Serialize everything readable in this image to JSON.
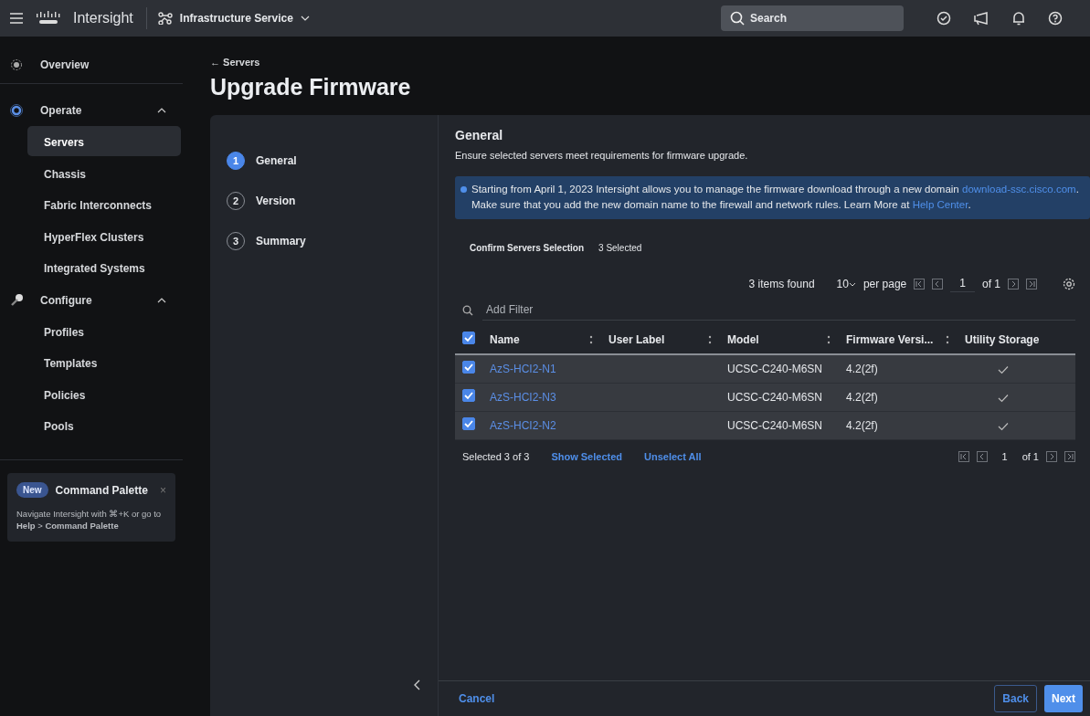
{
  "topbar": {
    "product": "Intersight",
    "service": "Infrastructure Service",
    "search": {
      "placeholder": "Search"
    }
  },
  "sidebar": {
    "items": [
      {
        "label": "Overview",
        "kind": "link"
      },
      {
        "label": "Operate",
        "kind": "group",
        "expanded": true,
        "children": [
          {
            "label": "Servers",
            "selected": true
          },
          {
            "label": "Chassis",
            "selected": false
          },
          {
            "label": "Fabric Interconnects",
            "selected": false
          },
          {
            "label": "HyperFlex Clusters",
            "selected": false
          },
          {
            "label": "Integrated Systems",
            "selected": false
          }
        ]
      },
      {
        "label": "Configure",
        "kind": "group",
        "expanded": true,
        "children": [
          {
            "label": "Profiles",
            "selected": false
          },
          {
            "label": "Templates",
            "selected": false
          },
          {
            "label": "Policies",
            "selected": false
          },
          {
            "label": "Pools",
            "selected": false
          }
        ]
      }
    ],
    "promo": {
      "badge": "New",
      "title": "Command Palette",
      "close": "×",
      "text": "Navigate Intersight with ⌘+K or go to **Help** > **Command Palette**"
    }
  },
  "page": {
    "back": "← Servers",
    "title": "Upgrade Firmware"
  },
  "steps": [
    {
      "number": "1",
      "label": "General",
      "selected": true
    },
    {
      "number": "2",
      "label": "Version",
      "selected": false
    },
    {
      "number": "3",
      "label": "Summary",
      "selected": false
    }
  ],
  "section": {
    "title": "General",
    "subtitle": "Ensure selected servers meet requirements for firmware upgrade.",
    "banner": [
      {
        "kind": "text",
        "text": "Starting from April 1, 2023 Intersight allows you to manage the firmware download through a new domain"
      },
      {
        "kind": "link",
        "text": "download-ssc.cisco.com"
      },
      {
        "kind": "text",
        "text": ". Make sure that you add the new domain name to the firewall and network rules. Learn More at"
      },
      {
        "kind": "link",
        "text": "Help Center"
      },
      {
        "kind": "text",
        "text": "."
      }
    ],
    "selection_label": "Confirm Servers Selection",
    "selection_count": "3 Selected"
  },
  "table": {
    "items_found": "3 items found",
    "page_size": "10",
    "per_page": "per page",
    "page": "1",
    "of_pages": "of 1",
    "filter": {
      "placeholder": "Add Filter"
    },
    "all_selected": true,
    "columns": [
      {
        "label": "Name",
        "sortable": true
      },
      {
        "label": "User Label",
        "sortable": true
      },
      {
        "label": "Model",
        "sortable": true
      },
      {
        "label": "Firmware Versi...",
        "sortable": true
      },
      {
        "label": "Utility Storage",
        "sortable": false
      }
    ],
    "rows": [
      {
        "selected": true,
        "name": "AzS-HCI2-N1",
        "model": "UCSC-C240-M6SN",
        "firmware": "4.2(2f)",
        "utility_storage": true
      },
      {
        "selected": true,
        "name": "AzS-HCI2-N3",
        "model": "UCSC-C240-M6SN",
        "firmware": "4.2(2f)",
        "utility_storage": true
      },
      {
        "selected": true,
        "name": "AzS-HCI2-N2",
        "model": "UCSC-C240-M6SN",
        "firmware": "4.2(2f)",
        "utility_storage": true
      }
    ],
    "footer": {
      "selected": "Selected 3 of 3",
      "show_selected": "Show Selected",
      "unselect_all": "Unselect All",
      "page": "1",
      "of_pages": "of 1"
    }
  },
  "actions": {
    "cancel": "Cancel",
    "back": "Back",
    "next": "Next"
  }
}
